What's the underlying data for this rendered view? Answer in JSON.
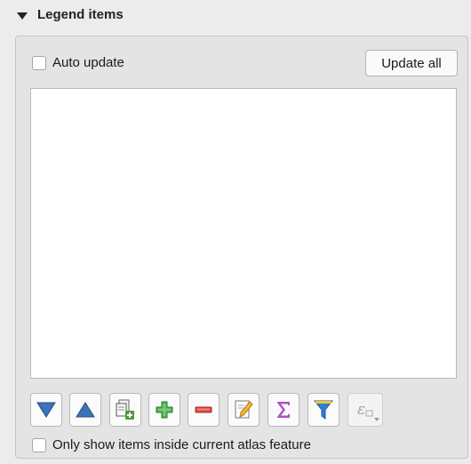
{
  "group": {
    "title": "Legend items",
    "collapse_icon": "triangle-down-icon"
  },
  "auto_update": {
    "label": "Auto update",
    "checked": false
  },
  "update_all_label": "Update all",
  "legend_list": {
    "items": []
  },
  "toolbar": {
    "buttons": [
      {
        "icon": "move-down-icon",
        "color": "#3b73b9",
        "enabled": true
      },
      {
        "icon": "move-up-icon",
        "color": "#3b73b9",
        "enabled": true
      },
      {
        "icon": "add-group-icon",
        "color": "#4a9c3a",
        "enabled": true
      },
      {
        "icon": "add-item-icon",
        "color": "#4caf50",
        "enabled": true
      },
      {
        "icon": "remove-item-icon",
        "color": "#e04848",
        "enabled": true
      },
      {
        "icon": "edit-item-icon",
        "color": "#e8a33a",
        "enabled": true
      },
      {
        "icon": "sum-icon",
        "color": "#b04fc4",
        "enabled": true
      },
      {
        "icon": "filter-icon",
        "color": "#2f7fd6",
        "enabled": true
      },
      {
        "icon": "expression-icon",
        "color": "#9a9a9a",
        "enabled": false
      }
    ]
  },
  "atlas_filter": {
    "label": "Only show items inside current atlas feature",
    "checked": false
  }
}
